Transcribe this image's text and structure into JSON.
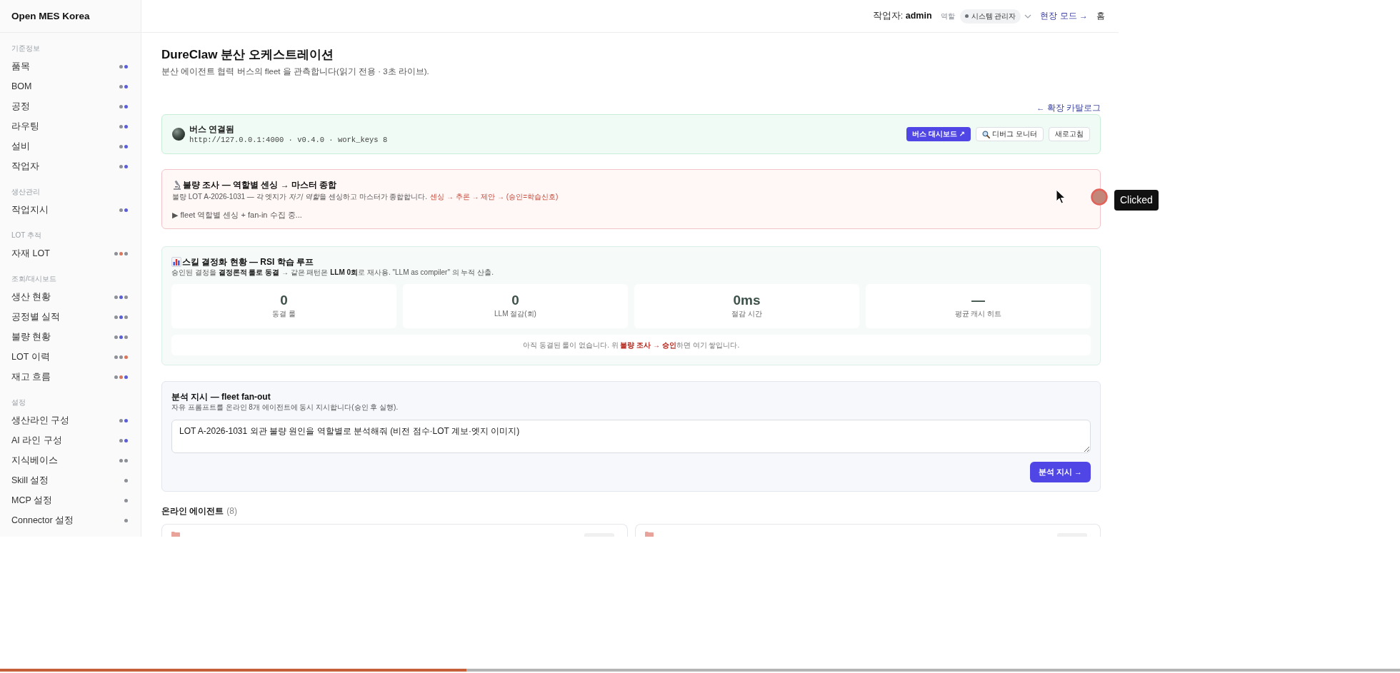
{
  "sidebar": {
    "brand": "Open MES Korea",
    "sections": [
      {
        "label": "기준정보",
        "items": [
          {
            "label": "품목",
            "dots": [
              {
                "color": "#8c8f96"
              },
              {
                "color": "#5b5fd6"
              }
            ]
          },
          {
            "label": "BOM",
            "dots": [
              {
                "color": "#8c8f96"
              },
              {
                "color": "#5b5fd6"
              }
            ]
          },
          {
            "label": "공정",
            "dots": [
              {
                "color": "#8c8f96"
              },
              {
                "color": "#5b5fd6"
              }
            ]
          },
          {
            "label": "라우팅",
            "dots": [
              {
                "color": "#8c8f96"
              },
              {
                "color": "#5b5fd6"
              }
            ]
          },
          {
            "label": "설비",
            "dots": [
              {
                "color": "#8c8f96"
              },
              {
                "color": "#5b5fd6"
              }
            ]
          },
          {
            "label": "작업자",
            "dots": [
              {
                "color": "#8c8f96"
              },
              {
                "color": "#5b5fd6"
              }
            ]
          }
        ]
      },
      {
        "label": "생산관리",
        "items": [
          {
            "label": "작업지시",
            "dots": [
              {
                "color": "#8c8f96"
              },
              {
                "color": "#5b5fd6"
              }
            ]
          }
        ]
      },
      {
        "label": "LOT 추적",
        "items": [
          {
            "label": "자재 LOT",
            "dots": [
              {
                "color": "#8c8f96"
              },
              {
                "color": "#d9775d"
              },
              {
                "color": "#8c8f96"
              }
            ]
          }
        ]
      },
      {
        "label": "조회/대시보드",
        "items": [
          {
            "label": "생산 현황",
            "dots": [
              {
                "color": "#8c8f96"
              },
              {
                "color": "#5b5fd6"
              },
              {
                "color": "#8c8f96"
              }
            ]
          },
          {
            "label": "공정별 실적",
            "dots": [
              {
                "color": "#8c8f96"
              },
              {
                "color": "#5b5fd6"
              },
              {
                "color": "#8c8f96"
              }
            ]
          },
          {
            "label": "불량 현황",
            "dots": [
              {
                "color": "#8c8f96"
              },
              {
                "color": "#5b5fd6"
              },
              {
                "color": "#8c8f96"
              }
            ]
          },
          {
            "label": "LOT 이력",
            "dots": [
              {
                "color": "#8c8f96"
              },
              {
                "color": "#8c8f96"
              },
              {
                "color": "#d9775d"
              }
            ]
          },
          {
            "label": "재고 흐름",
            "dots": [
              {
                "color": "#8c8f96"
              },
              {
                "color": "#d9775d"
              },
              {
                "color": "#5b5fd6"
              }
            ]
          }
        ]
      },
      {
        "label": "설정",
        "items": [
          {
            "label": "생산라인 구성",
            "dots": [
              {
                "color": "#8c8f96"
              },
              {
                "color": "#5b5fd6"
              }
            ]
          },
          {
            "label": "AI 라인 구성",
            "dots": [
              {
                "color": "#8c8f96"
              },
              {
                "color": "#5b5fd6"
              }
            ]
          },
          {
            "label": "지식베이스",
            "dots": [
              {
                "color": "#8c8f96"
              },
              {
                "color": "#8c8f96"
              }
            ]
          },
          {
            "label": "Skill 설정",
            "dots": [
              {
                "color": "#8c8f96"
              }
            ]
          },
          {
            "label": "MCP 설정",
            "dots": [
              {
                "color": "#8c8f96"
              }
            ]
          },
          {
            "label": "Connector 설정",
            "dots": [
              {
                "color": "#8c8f96"
              }
            ]
          }
        ]
      }
    ]
  },
  "header": {
    "user": "작업자: **admin**",
    "role_label": "역할",
    "role": "시스템 관리자",
    "field_mode_link": "현장 모드 →",
    "home_link": "홈"
  },
  "page": {
    "title": "DureClaw 분산 오케스트레이션",
    "subtitle": "분산 에이전트 협력 버스의 fleet 을 관측합니다(읽기 전용 · 3초 라이브).",
    "catalog_link": "← 확장 카탈로그"
  },
  "bus_card": {
    "status": "버스 연결됨",
    "details": "http://127.0.0.1:4000 · v0.4.0 · work_keys 8",
    "buttons": [
      {
        "label": "버스 대시보드 ↗",
        "kind": "primary"
      },
      {
        "label": "디버그 모니터",
        "kind": "search"
      },
      {
        "label": "새로고침",
        "kind": "plain"
      }
    ]
  },
  "investigation_card": {
    "title": "불량 조사 — 역할별 센싱 → 마스터 종합",
    "description": [
      {
        "text": "불량 LOT A-2026-1031 — 각 엣지가 ",
        "italic": false
      },
      {
        "text": "자기 역할",
        "italic": true
      },
      {
        "text": "을 센싱하고 마스터가 종합합니다.",
        "italic": false
      }
    ],
    "pipeline": "센싱 → 추론 → 제안 → (승인=학습신호)",
    "status": "▶ fleet 역할별 센싱 + fan-in 수집 중..."
  },
  "skill_card": {
    "title": "스킬 결정화 현황 — RSI 학습 루프",
    "description": "승인된 결정을 **결정론적 룰로 동결** → 같은 패턴은 **LLM 0회**로 재사용. \"LLM as compiler\" 의 누적 산출.",
    "stats": [
      {
        "value": "0",
        "label": "동결 룰"
      },
      {
        "value": "0",
        "label": "LLM 절감(회)"
      },
      {
        "value": "0ms",
        "label": "절감 시간"
      },
      {
        "value": "—",
        "label": "평균 캐시 히트"
      }
    ],
    "empty_message": "아직 동결된 룰이 없습니다. 위 **불량 조사 → 승인**하면 여기 쌓입니다."
  },
  "analysis_card": {
    "title": "분석 지시 — fleet fan-out",
    "description": "자유 프롬프트를 온라인 8개 에이전트에 동시 지시합니다(승인 후 실행).",
    "prompt": {
      "value": "LOT A-2026-1031 외관 불량 원인을 역할별로 분석해줘 (비전 점수·LOT 계보·엣지 이미지)"
    },
    "submit_button": "분석 지시 →"
  },
  "agents": {
    "heading": "온라인 에이전트",
    "count": "(8)"
  },
  "click_indicator": {
    "label": "Clicked"
  },
  "playback_bar": {
    "level": 0.333
  }
}
